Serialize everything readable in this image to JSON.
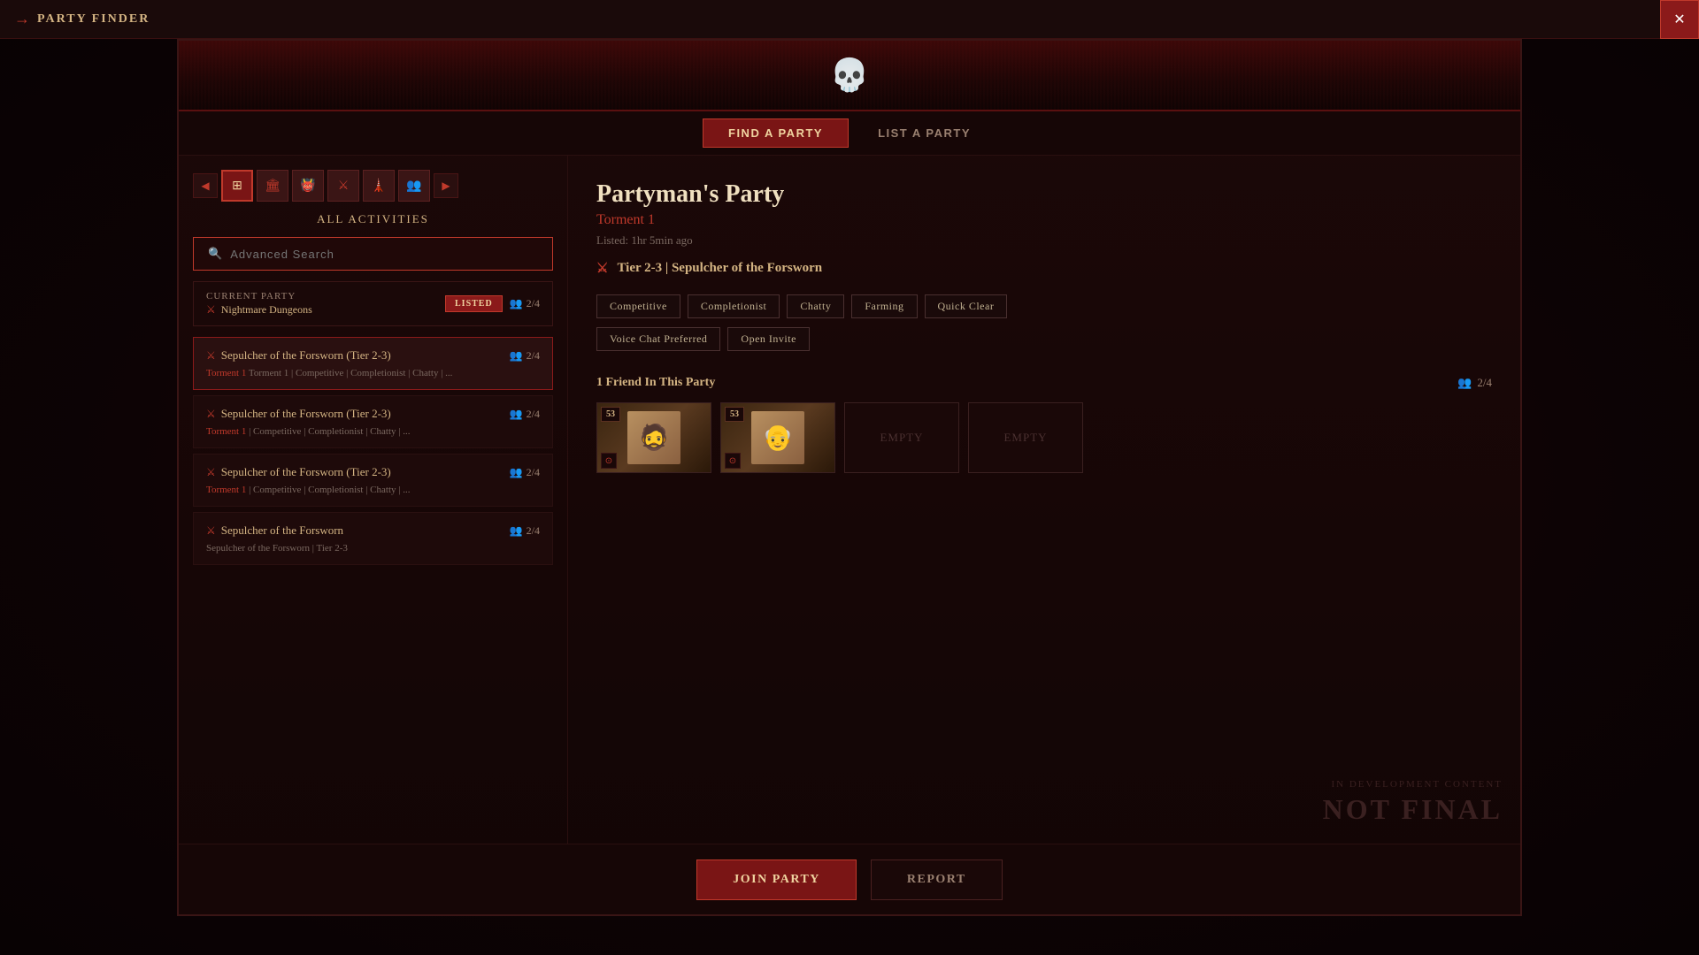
{
  "titleBar": {
    "title": "PARTY FINDER",
    "closeLabel": "✕"
  },
  "tabs": [
    {
      "id": "find",
      "label": "FIND A PARTY",
      "active": true
    },
    {
      "id": "list",
      "label": "LIST A PARTY",
      "active": false
    }
  ],
  "leftPanel": {
    "allActivitiesLabel": "ALL ACTIVITIES",
    "searchPlaceholder": "Advanced Search",
    "currentParty": {
      "label": "Current Party",
      "name": "Nightmare Dungeons",
      "badge": "LISTED",
      "count": "2/4"
    },
    "partyList": [
      {
        "name": "Sepulcher of the Forsworn (Tier 2-3)",
        "count": "2/4",
        "tags": "Torment 1  |  Competitive  |  Completionist  |  Chatty  | ..."
      },
      {
        "name": "Sepulcher of the Forsworn (Tier 2-3)",
        "count": "2/4",
        "tags": "Torment 1  |  Competitive  |  Completionist  |  Chatty  | ..."
      },
      {
        "name": "Sepulcher of the Forsworn (Tier 2-3)",
        "count": "2/4",
        "tags": "Torment 1  |  Competitive  |  Completionist  |  Chatty  | ..."
      },
      {
        "name": "Sepulcher of the Forsworn",
        "count": "2/4",
        "tags": "Sepulcher of the Forsworn | Tier 2-3"
      }
    ]
  },
  "rightPanel": {
    "partyName": "Partyman's Party",
    "difficulty": "Torment 1",
    "listedTime": "Listed: 1hr 5min ago",
    "dungeonInfo": "Tier 2-3  |  Sepulcher of the Forsworn",
    "tags": [
      "Competitive",
      "Completionist",
      "Chatty",
      "Farming",
      "Quick Clear",
      "Voice Chat Preferred",
      "Open Invite"
    ],
    "friendsSection": {
      "label": "1 Friend In This Party",
      "count": "2/4",
      "slots": [
        {
          "filled": true,
          "level": "53",
          "hasClassIcon": true
        },
        {
          "filled": true,
          "level": "53",
          "hasClassIcon": true
        },
        {
          "filled": false,
          "label": "EMPTY"
        },
        {
          "filled": false,
          "label": "EMPTY"
        }
      ]
    },
    "watermark": {
      "subText": "IN DEVELOPMENT CONTENT",
      "mainText": "NOT FINAL"
    }
  },
  "bottomBar": {
    "joinButton": "Join Party",
    "reportButton": "Report"
  },
  "icons": {
    "skull": "💀",
    "dungeon": "⚔",
    "players": "👥",
    "search": "🔍",
    "arrow": "→",
    "chevronLeft": "◀",
    "chevronRight": "▶"
  }
}
